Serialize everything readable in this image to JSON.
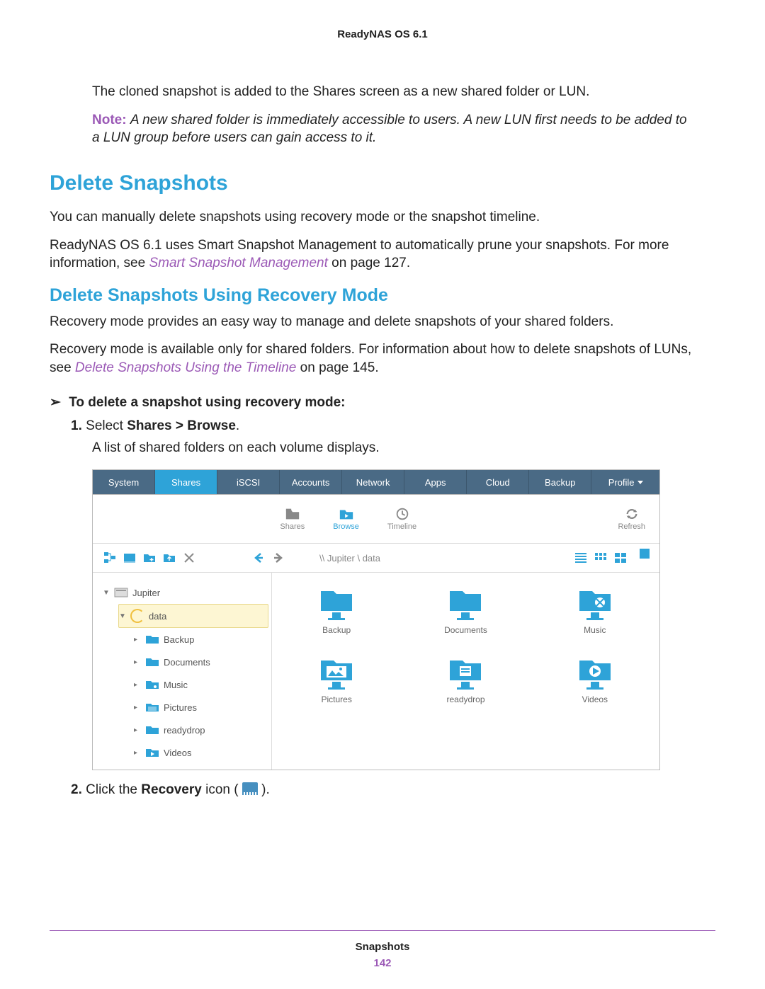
{
  "header": "ReadyNAS OS 6.1",
  "intro": "The cloned snapshot is added to the Shares screen as a new shared folder or LUN.",
  "note_label": "Note:",
  "note_body": "A new shared folder is immediately accessible to users. A new LUN first needs to be added to a LUN group before users can gain access to it.",
  "h2": "Delete Snapshots",
  "p1": "You can manually delete snapshots using recovery mode or the snapshot timeline.",
  "p2a": "ReadyNAS OS 6.1 uses Smart Snapshot Management to automatically prune your snapshots. For more information, see ",
  "p2link": "Smart Snapshot Management",
  "p2b": " on page 127.",
  "h3": "Delete Snapshots Using Recovery Mode",
  "p3": "Recovery mode provides an easy way to manage and delete snapshots of your shared folders.",
  "p4a": "Recovery mode is available only for shared folders. For information about how to delete snapshots of LUNs, see ",
  "p4link": "Delete Snapshots Using the Timeline",
  "p4b": " on page 145.",
  "proc_head": "To delete a snapshot using recovery mode:",
  "proc_arrow": "➢",
  "step1_num": "1.",
  "step1_a": "Select ",
  "step1_b": "Shares > Browse",
  "step1_c": ".",
  "step1_sub": "A list of shared folders on each volume displays.",
  "step2_num": "2.",
  "step2_a": "Click the ",
  "step2_b": "Recovery",
  "step2_c": " icon ( ",
  "step2_d": " ).",
  "footer_section": "Snapshots",
  "footer_page": "142",
  "shot": {
    "nav": [
      "System",
      "Shares",
      "iSCSI",
      "Accounts",
      "Network",
      "Apps",
      "Cloud",
      "Backup"
    ],
    "profile": "Profile",
    "subnav": {
      "shares": "Shares",
      "browse": "Browse",
      "timeline": "Timeline",
      "refresh": "Refresh"
    },
    "breadcrumb": "\\\\ Jupiter \\ data",
    "tree": {
      "root": "Jupiter",
      "sel": "data",
      "items": [
        "Backup",
        "Documents",
        "Music",
        "Pictures",
        "readydrop",
        "Videos"
      ]
    },
    "grid": [
      "Backup",
      "Documents",
      "Music",
      "Pictures",
      "readydrop",
      "Videos"
    ]
  }
}
